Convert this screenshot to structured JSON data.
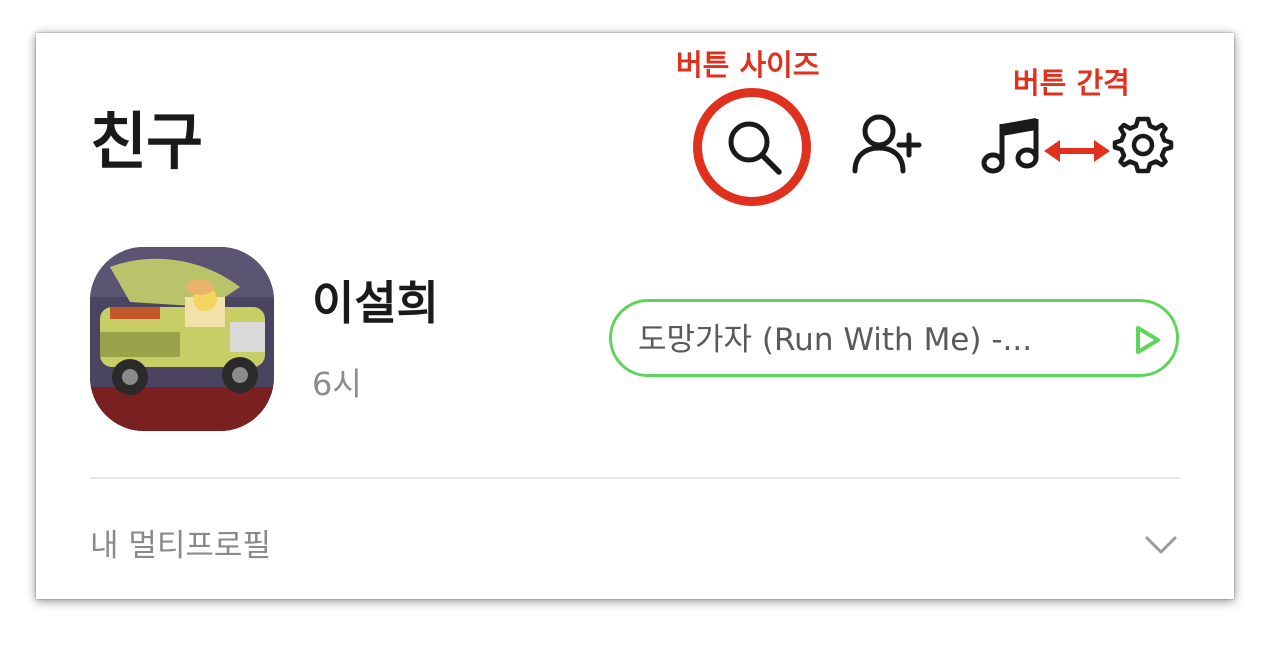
{
  "header": {
    "title": "친구",
    "icons": [
      "search-icon",
      "add-friend-icon",
      "music-icon",
      "gear-icon"
    ]
  },
  "annotations": {
    "button_size": "버튼 사이즈",
    "button_spacing": "버튼 간격",
    "color": "#e0301e"
  },
  "profile": {
    "name": "이설희",
    "time": "6시",
    "music": "도망가자 (Run With Me) -...",
    "music_border_color": "#5dd45a"
  },
  "multi_profile": {
    "label": "내 멀티프로필",
    "icon": "chevron-down-icon"
  }
}
